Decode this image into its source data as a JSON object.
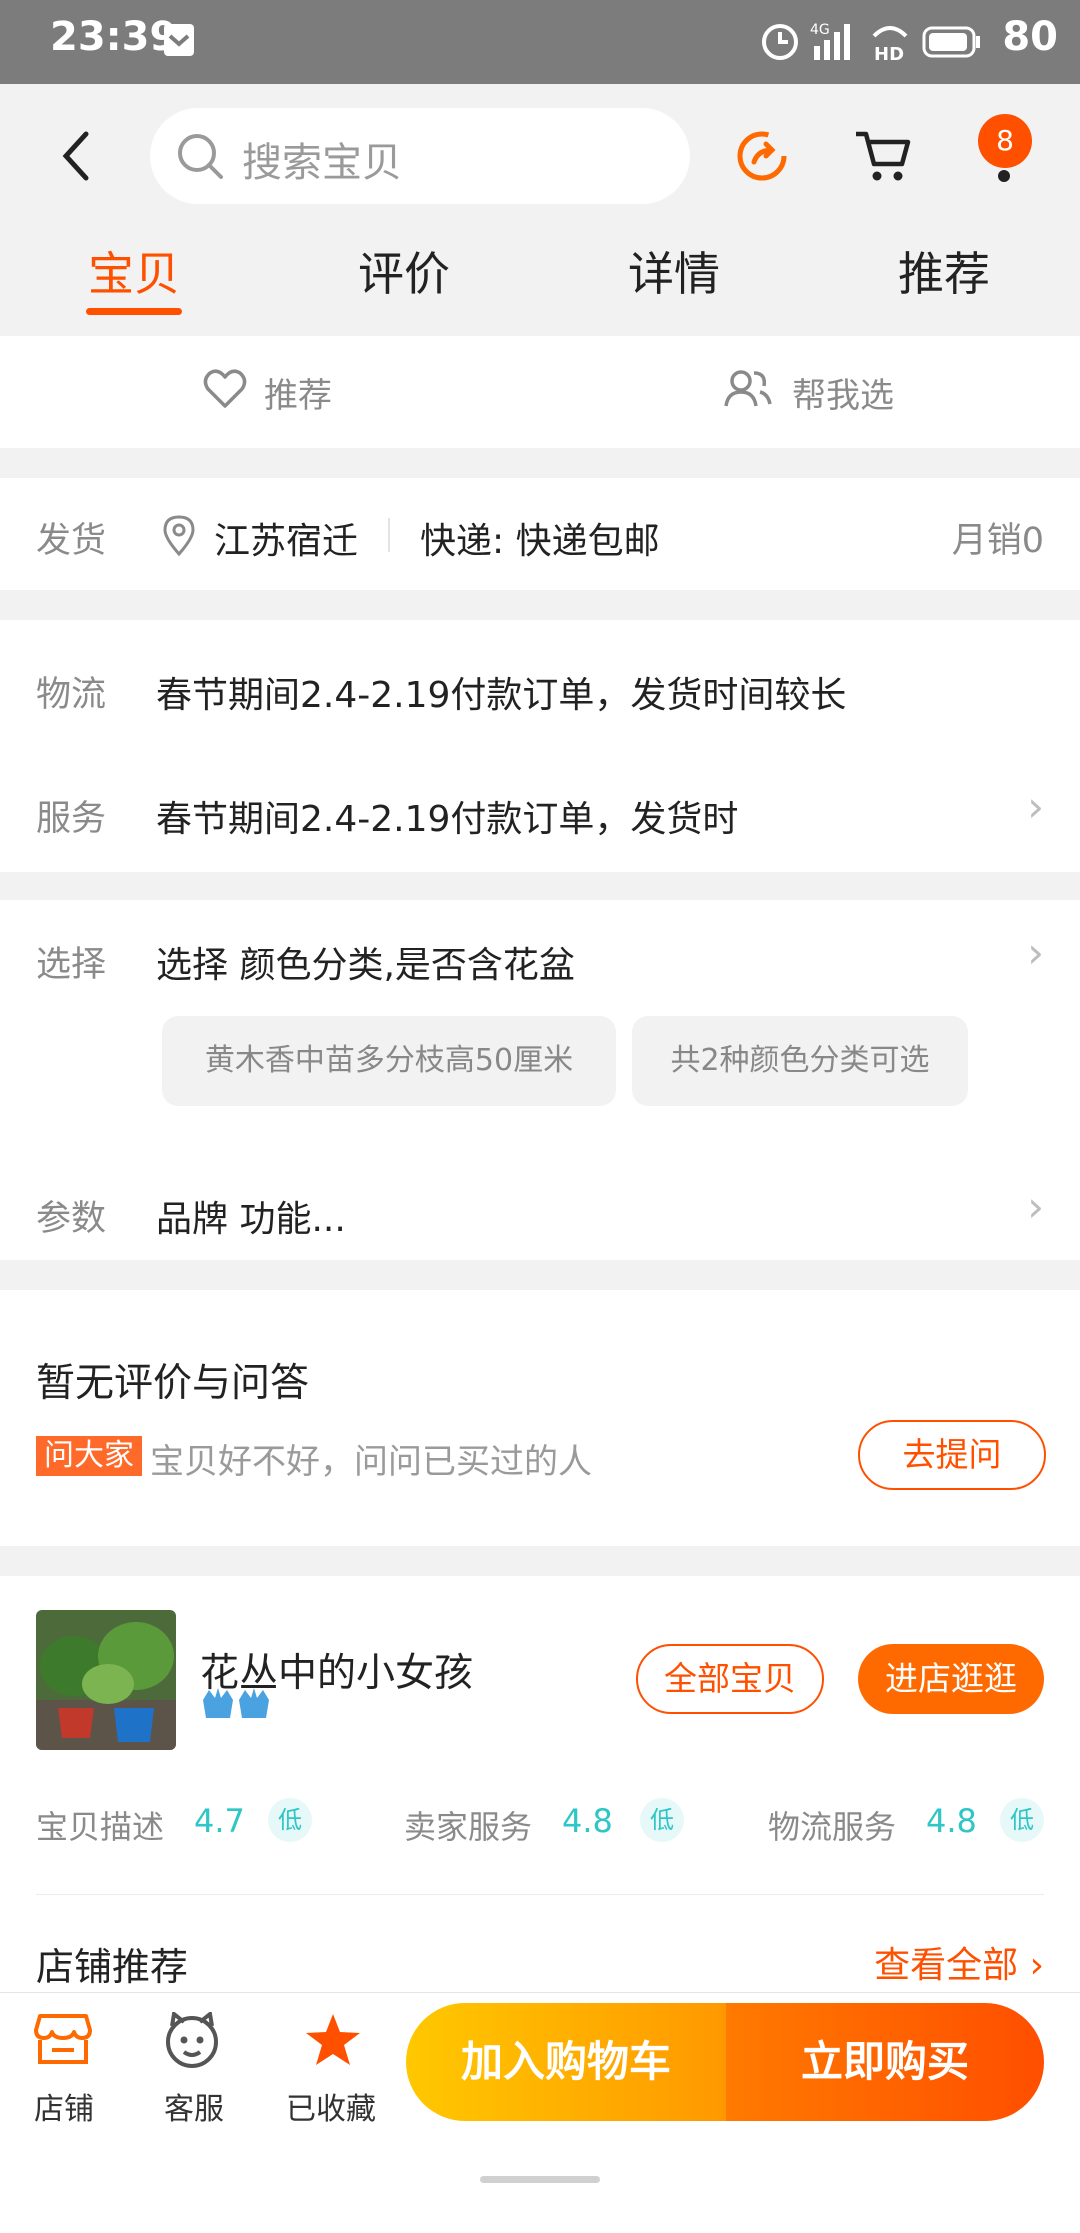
{
  "status": {
    "time": "23:39",
    "network": "4G",
    "battery": "80"
  },
  "header": {
    "search_placeholder": "搜索宝贝",
    "cart_badge": "8",
    "tabs": [
      {
        "label": "宝贝",
        "active": true
      },
      {
        "label": "评价",
        "active": false
      },
      {
        "label": "详情",
        "active": false
      },
      {
        "label": "推荐",
        "active": false
      }
    ]
  },
  "quick_actions": {
    "recommend": "推荐",
    "help_choose": "帮我选"
  },
  "shipping": {
    "label": "发货",
    "location": "江苏宿迁",
    "express": "快递: 快递包邮",
    "monthly_sales": "月销0"
  },
  "logistics": {
    "label": "物流",
    "text": "春节期间2.4-2.19付款订单，发货时间较长"
  },
  "service": {
    "label": "服务",
    "text": "春节期间2.4-2.19付款订单，发货时"
  },
  "select": {
    "label": "选择",
    "text": "选择 颜色分类,是否含花盆",
    "chips": [
      "黄木香中苗多分枝高50厘米",
      "共2种颜色分类可选"
    ]
  },
  "params": {
    "label": "参数",
    "text": "品牌 功能..."
  },
  "qa": {
    "title": "暂无评价与问答",
    "tag": "问大家",
    "hint": "宝贝好不好，问问已买过的人",
    "ask_button": "去提问"
  },
  "shop": {
    "name": "花丛中的小女孩",
    "all_items_button": "全部宝贝",
    "enter_shop_button": "进店逛逛",
    "scores": [
      {
        "label": "宝贝描述",
        "value": "4.7",
        "level": "低"
      },
      {
        "label": "卖家服务",
        "value": "4.8",
        "level": "低"
      },
      {
        "label": "物流服务",
        "value": "4.8",
        "level": "低"
      }
    ],
    "recommend_title": "店铺推荐",
    "view_all": "查看全部"
  },
  "bottom_bar": {
    "shop": "店铺",
    "service": "客服",
    "favorited": "已收藏",
    "add_to_cart": "加入购物车",
    "buy_now": "立即购买"
  },
  "colors": {
    "accent": "#ff5000",
    "score": "#2ec6c6"
  }
}
